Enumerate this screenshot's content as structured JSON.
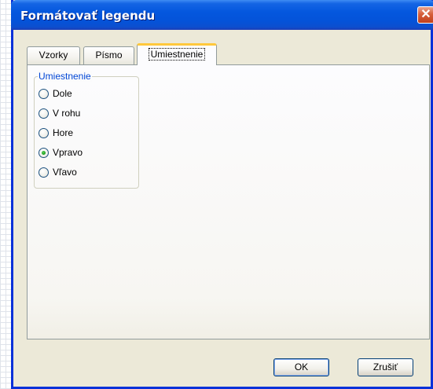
{
  "window": {
    "title": "Formátovať legendu"
  },
  "tabs": [
    {
      "label": "Vzorky",
      "active": false
    },
    {
      "label": "Písmo",
      "active": false
    },
    {
      "label": "Umiestnenie",
      "active": true
    }
  ],
  "placement_group": {
    "label": "Umiestnenie",
    "options": [
      {
        "label": "Dole",
        "checked": false
      },
      {
        "label": "V rohu",
        "checked": false
      },
      {
        "label": "Hore",
        "checked": false
      },
      {
        "label": "Vpravo",
        "checked": true
      },
      {
        "label": "Vľavo",
        "checked": false
      }
    ]
  },
  "buttons": {
    "ok_label": "OK",
    "cancel_label": "Zrušiť"
  },
  "colors": {
    "titlebar": "#0453d9",
    "window_border": "#0831d9",
    "dialog_background": "#ece9d8",
    "group_label": "#0046d5",
    "active_tab_accent": "#ffc83c",
    "close_button": "#d65f3b"
  }
}
